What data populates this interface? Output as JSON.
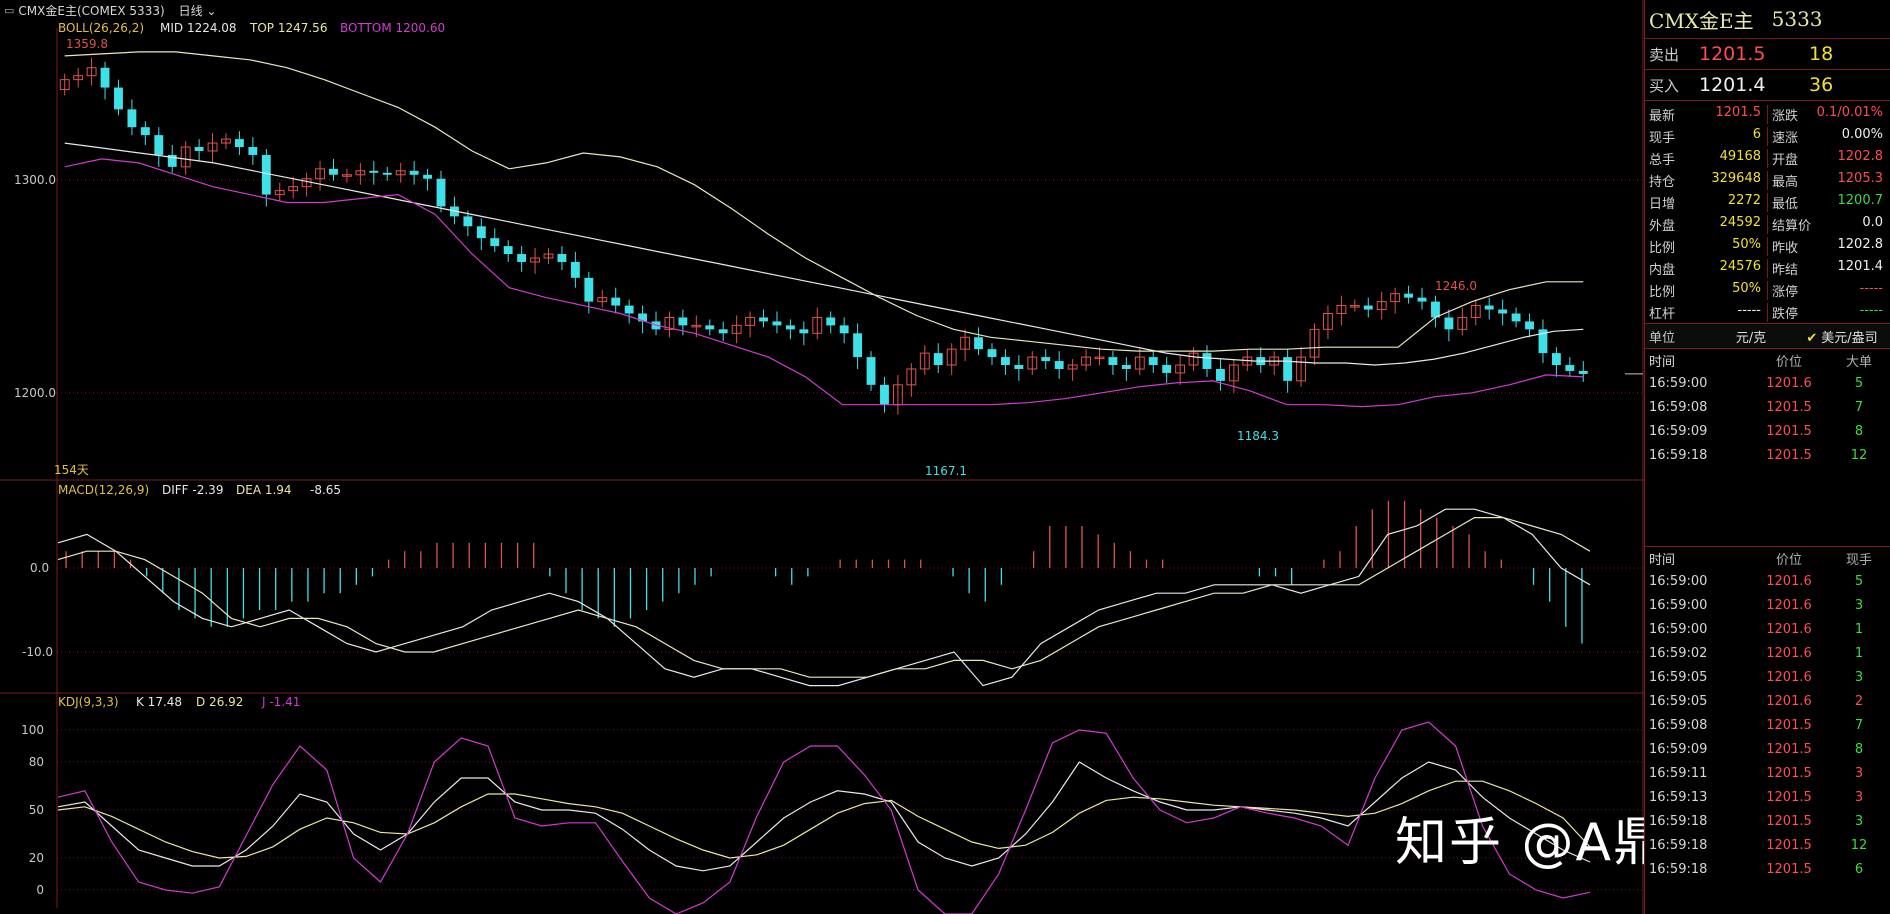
{
  "header": {
    "symbol": "CMX金E主(COMEX 5333)",
    "period": "日线"
  },
  "main_panel": {
    "indicator": "BOLL(26,26,2)",
    "mid": "MID 1224.08",
    "top": "TOP 1247.56",
    "bottom": "BOTTOM 1200.60",
    "yticks": [
      "1300.0",
      "1200.0"
    ],
    "annotations": {
      "high": "1359.8",
      "low": "1167.1",
      "low2": "1184.3",
      "high2": "1246.0"
    },
    "days": "154天"
  },
  "macd_panel": {
    "indicator": "MACD(12,26,9)",
    "diff": "DIFF -2.39",
    "dea": "DEA 1.94",
    "macd": "-8.65",
    "yticks": [
      "0.0",
      "-10.0"
    ]
  },
  "kdj_panel": {
    "indicator": "KDJ(9,3,3)",
    "k": "K 17.48",
    "d": "D 26.92",
    "j": "J -1.41",
    "yticks": [
      "100",
      "80",
      "50",
      "20",
      "0"
    ]
  },
  "chart_data": [
    {
      "type": "candlestick",
      "title": "CMX金E主(COMEX 5333) 日线 BOLL(26,26,2)",
      "ylim": [
        1150,
        1370
      ],
      "series": [
        {
          "name": "MID",
          "values": [
            1318,
            1316,
            1314,
            1312,
            1310,
            1308,
            1305,
            1302,
            1299,
            1296,
            1293,
            1290,
            1287,
            1284,
            1281,
            1278,
            1275,
            1272,
            1269,
            1266,
            1263,
            1260,
            1257,
            1254,
            1251,
            1248,
            1245,
            1242,
            1239,
            1236,
            1233,
            1230,
            1227,
            1224,
            1221,
            1218,
            1215,
            1212,
            1210,
            1209,
            1208,
            1208,
            1207,
            1207,
            1206,
            1207,
            1209,
            1212,
            1216,
            1220,
            1223,
            1224
          ]
        },
        {
          "name": "TOP",
          "values": [
            1362,
            1363,
            1364,
            1364,
            1362,
            1360,
            1356,
            1350,
            1343,
            1336,
            1326,
            1314,
            1305,
            1308,
            1313,
            1311,
            1306,
            1297,
            1285,
            1272,
            1260,
            1250,
            1240,
            1231,
            1224,
            1220,
            1218,
            1216,
            1214,
            1213,
            1213,
            1213,
            1214,
            1214,
            1215,
            1215,
            1215,
            1230,
            1238,
            1244,
            1248,
            1248
          ]
        },
        {
          "name": "BOTTOM",
          "values": [
            1306,
            1310,
            1308,
            1302,
            1296,
            1292,
            1288,
            1288,
            1290,
            1292,
            1282,
            1262,
            1245,
            1240,
            1236,
            1232,
            1226,
            1222,
            1216,
            1210,
            1200,
            1186,
            1186,
            1186,
            1186,
            1186,
            1187,
            1189,
            1192,
            1195,
            1197,
            1198,
            1193,
            1186,
            1186,
            1185,
            1186,
            1190,
            1192,
            1196,
            1201,
            1200
          ]
        }
      ],
      "close_start": 1345,
      "close_end": 1201.5,
      "closes": [
        1350,
        1352,
        1356,
        1346,
        1335,
        1326,
        1322,
        1312,
        1306,
        1316,
        1314,
        1318,
        1320,
        1316,
        1312,
        1292,
        1294,
        1296,
        1300,
        1305,
        1302,
        1302,
        1304,
        1303,
        1302,
        1304,
        1302,
        1300,
        1286,
        1281,
        1276,
        1270,
        1266,
        1262,
        1258,
        1260,
        1262,
        1258,
        1250,
        1238,
        1240,
        1236,
        1232,
        1228,
        1224,
        1230,
        1226,
        1226,
        1224,
        1222,
        1226,
        1230,
        1228,
        1226,
        1224,
        1222,
        1230,
        1226,
        1222,
        1210,
        1196,
        1186,
        1196,
        1204,
        1212,
        1206,
        1214,
        1220,
        1214,
        1210,
        1206,
        1204,
        1210,
        1208,
        1204,
        1206,
        1210,
        1210,
        1206,
        1204,
        1210,
        1206,
        1202,
        1206,
        1212,
        1204,
        1198,
        1206,
        1210,
        1206,
        1210,
        1198,
        1210,
        1224,
        1232,
        1236,
        1236,
        1234,
        1238,
        1242,
        1240,
        1238,
        1230,
        1224,
        1230,
        1236,
        1234,
        1232,
        1228,
        1224,
        1212,
        1206,
        1203,
        1201.5
      ]
    },
    {
      "type": "bar",
      "title": "MACD(12,26,9)",
      "ylim": [
        -15,
        6
      ],
      "series": [
        {
          "name": "MACD",
          "values": [
            2,
            2,
            2,
            2,
            1,
            -1,
            -3,
            -5,
            -6,
            -7,
            -7,
            -6,
            -5,
            -5,
            -4,
            -4,
            -3,
            -3,
            -2,
            -1,
            1,
            2,
            2,
            3,
            3,
            3,
            3,
            3,
            3,
            3,
            -1,
            -3,
            -5,
            -6,
            -7,
            -6,
            -5,
            -4,
            -3,
            -2,
            -1,
            0,
            0,
            0,
            -1,
            -2,
            -1,
            0,
            1,
            1,
            1,
            1,
            1,
            1,
            0,
            -1,
            -3,
            -4,
            -2,
            0,
            2,
            5,
            5,
            5,
            4,
            3,
            2,
            1,
            1,
            0,
            0,
            0,
            0,
            0,
            -1,
            -1,
            -2,
            0,
            1,
            2,
            5,
            7,
            8,
            8,
            7,
            6,
            5,
            4,
            2,
            1,
            0,
            -2,
            -4,
            -7,
            -9
          ]
        },
        {
          "name": "DIFF",
          "values": [
            3,
            4,
            2,
            -1,
            -4,
            -6,
            -7,
            -6,
            -5,
            -7,
            -9,
            -10,
            -9,
            -8,
            -7,
            -5,
            -4,
            -3,
            -4,
            -6,
            -9,
            -12,
            -13,
            -12,
            -12,
            -13,
            -14,
            -14,
            -13,
            -12,
            -11,
            -10,
            -14,
            -13,
            -9,
            -7,
            -5,
            -4,
            -3,
            -3,
            -2,
            -2,
            -2,
            -3,
            -2,
            -1,
            4,
            5,
            7,
            7,
            6,
            4,
            0,
            -2
          ]
        },
        {
          "name": "DEA",
          "values": [
            1,
            2,
            2,
            1,
            -1,
            -3,
            -6,
            -7,
            -6,
            -6,
            -7,
            -9,
            -10,
            -10,
            -9,
            -8,
            -7,
            -6,
            -5,
            -6,
            -7,
            -9,
            -11,
            -12,
            -12,
            -12,
            -13,
            -13,
            -13,
            -12,
            -12,
            -11,
            -11,
            -12,
            -11,
            -9,
            -7,
            -6,
            -5,
            -4,
            -3,
            -3,
            -2,
            -2,
            -2,
            -2,
            0,
            2,
            4,
            6,
            6,
            5,
            4,
            2
          ]
        }
      ]
    },
    {
      "type": "line",
      "title": "KDJ(9,3,3)",
      "ylim": [
        -5,
        110
      ],
      "series": [
        {
          "name": "K",
          "values": [
            52,
            55,
            40,
            25,
            20,
            15,
            15,
            25,
            40,
            60,
            55,
            35,
            25,
            35,
            55,
            70,
            70,
            55,
            50,
            50,
            48,
            38,
            25,
            15,
            12,
            15,
            30,
            45,
            55,
            62,
            60,
            55,
            30,
            20,
            15,
            20,
            35,
            55,
            80,
            70,
            62,
            55,
            50,
            50,
            52,
            50,
            48,
            45,
            40,
            55,
            70,
            80,
            75,
            58,
            45,
            35,
            25,
            17.48
          ]
        },
        {
          "name": "D",
          "values": [
            50,
            52,
            46,
            38,
            30,
            24,
            20,
            21,
            27,
            38,
            45,
            42,
            36,
            35,
            42,
            52,
            60,
            60,
            57,
            54,
            52,
            48,
            40,
            32,
            25,
            20,
            22,
            28,
            38,
            48,
            54,
            56,
            46,
            38,
            30,
            26,
            28,
            36,
            48,
            56,
            58,
            57,
            55,
            53,
            52,
            51,
            50,
            48,
            46,
            48,
            54,
            62,
            68,
            68,
            62,
            54,
            45,
            26.92
          ]
        },
        {
          "name": "J",
          "values": [
            58,
            62,
            30,
            5,
            0,
            -2,
            2,
            34,
            66,
            90,
            75,
            20,
            5,
            35,
            80,
            95,
            90,
            45,
            40,
            42,
            42,
            18,
            -5,
            -15,
            -8,
            5,
            46,
            80,
            90,
            90,
            72,
            50,
            0,
            -15,
            -15,
            10,
            50,
            92,
            100,
            98,
            70,
            50,
            42,
            45,
            52,
            48,
            45,
            40,
            28,
            70,
            100,
            105,
            90,
            40,
            10,
            0,
            -5,
            -1.41
          ]
        }
      ]
    }
  ],
  "quote": {
    "title": "CMX金E主",
    "code": "5333",
    "sell_label": "卖出",
    "sell_price": "1201.5",
    "sell_vol": "18",
    "buy_label": "买入",
    "buy_price": "1201.4",
    "buy_vol": "36",
    "rows": [
      {
        "k1": "最新",
        "v1": "1201.5",
        "c1": "red",
        "k2": "涨跌",
        "v2": "0.1/0.01%",
        "c2": "red"
      },
      {
        "k1": "现手",
        "v1": "6",
        "c1": "yellow",
        "k2": "速涨",
        "v2": "0.00%",
        "c2": "white"
      },
      {
        "k1": "总手",
        "v1": "49168",
        "c1": "yellow",
        "k2": "开盘",
        "v2": "1202.8",
        "c2": "red"
      },
      {
        "k1": "持仓",
        "v1": "329648",
        "c1": "yellow",
        "k2": "最高",
        "v2": "1205.3",
        "c2": "red"
      },
      {
        "k1": "日增",
        "v1": "2272",
        "c1": "yellow",
        "k2": "最低",
        "v2": "1200.7",
        "c2": "green"
      },
      {
        "k1": "外盘",
        "v1": "24592",
        "c1": "yellow",
        "k2": "结算价",
        "v2": "0.0",
        "c2": "white"
      },
      {
        "k1": "比例",
        "v1": "50%",
        "c1": "yellow",
        "k2": "昨收",
        "v2": "1202.8",
        "c2": "white"
      },
      {
        "k1": "内盘",
        "v1": "24576",
        "c1": "yellow",
        "k2": "昨结",
        "v2": "1201.4",
        "c2": "white"
      },
      {
        "k1": "比例",
        "v1": "50%",
        "c1": "yellow",
        "k2": "涨停",
        "v2": "-----",
        "c2": "red"
      },
      {
        "k1": "杠杆",
        "v1": "-----",
        "c1": "white",
        "k2": "跌停",
        "v2": "-----",
        "c2": "green"
      }
    ],
    "unit_label": "单位",
    "unit_value": "元/克",
    "unit_option": "美元/盎司"
  },
  "big_orders": {
    "headers": [
      "时间",
      "价位",
      "大单"
    ],
    "rows": [
      {
        "t": "16:59:00",
        "p": "1201.6",
        "v": "5",
        "vc": "green"
      },
      {
        "t": "16:59:08",
        "p": "1201.5",
        "v": "7",
        "vc": "green"
      },
      {
        "t": "16:59:09",
        "p": "1201.5",
        "v": "8",
        "vc": "green"
      },
      {
        "t": "16:59:18",
        "p": "1201.5",
        "v": "12",
        "vc": "green"
      }
    ]
  },
  "ticks": {
    "headers": [
      "时间",
      "价位",
      "现手"
    ],
    "rows": [
      {
        "t": "16:59:00",
        "p": "1201.6",
        "v": "5",
        "vc": "green"
      },
      {
        "t": "16:59:00",
        "p": "1201.6",
        "v": "3",
        "vc": "green"
      },
      {
        "t": "16:59:00",
        "p": "1201.6",
        "v": "1",
        "vc": "green"
      },
      {
        "t": "16:59:02",
        "p": "1201.6",
        "v": "1",
        "vc": "green"
      },
      {
        "t": "16:59:05",
        "p": "1201.6",
        "v": "3",
        "vc": "green"
      },
      {
        "t": "16:59:05",
        "p": "1201.6",
        "v": "2",
        "vc": "red"
      },
      {
        "t": "16:59:08",
        "p": "1201.5",
        "v": "7",
        "vc": "green"
      },
      {
        "t": "16:59:09",
        "p": "1201.5",
        "v": "8",
        "vc": "green"
      },
      {
        "t": "16:59:11",
        "p": "1201.5",
        "v": "3",
        "vc": "red"
      },
      {
        "t": "16:59:13",
        "p": "1201.5",
        "v": "3",
        "vc": "red"
      },
      {
        "t": "16:59:18",
        "p": "1201.5",
        "v": "3",
        "vc": "green"
      },
      {
        "t": "16:59:18",
        "p": "1201.5",
        "v": "12",
        "vc": "green"
      },
      {
        "t": "16:59:18",
        "p": "1201.5",
        "v": "6",
        "vc": "green"
      }
    ]
  },
  "watermark": "知乎 @A鼎丰淘金",
  "colors": {
    "up": "#e0524e",
    "down": "#3fe0e8",
    "mid": "#e8e8e8",
    "top": "#e8e8c0",
    "bottom": "#d23ad2",
    "k": "#e8e8e8",
    "d": "#e8e8a0",
    "j": "#d23ad2",
    "grid": "#7a1b1b"
  }
}
